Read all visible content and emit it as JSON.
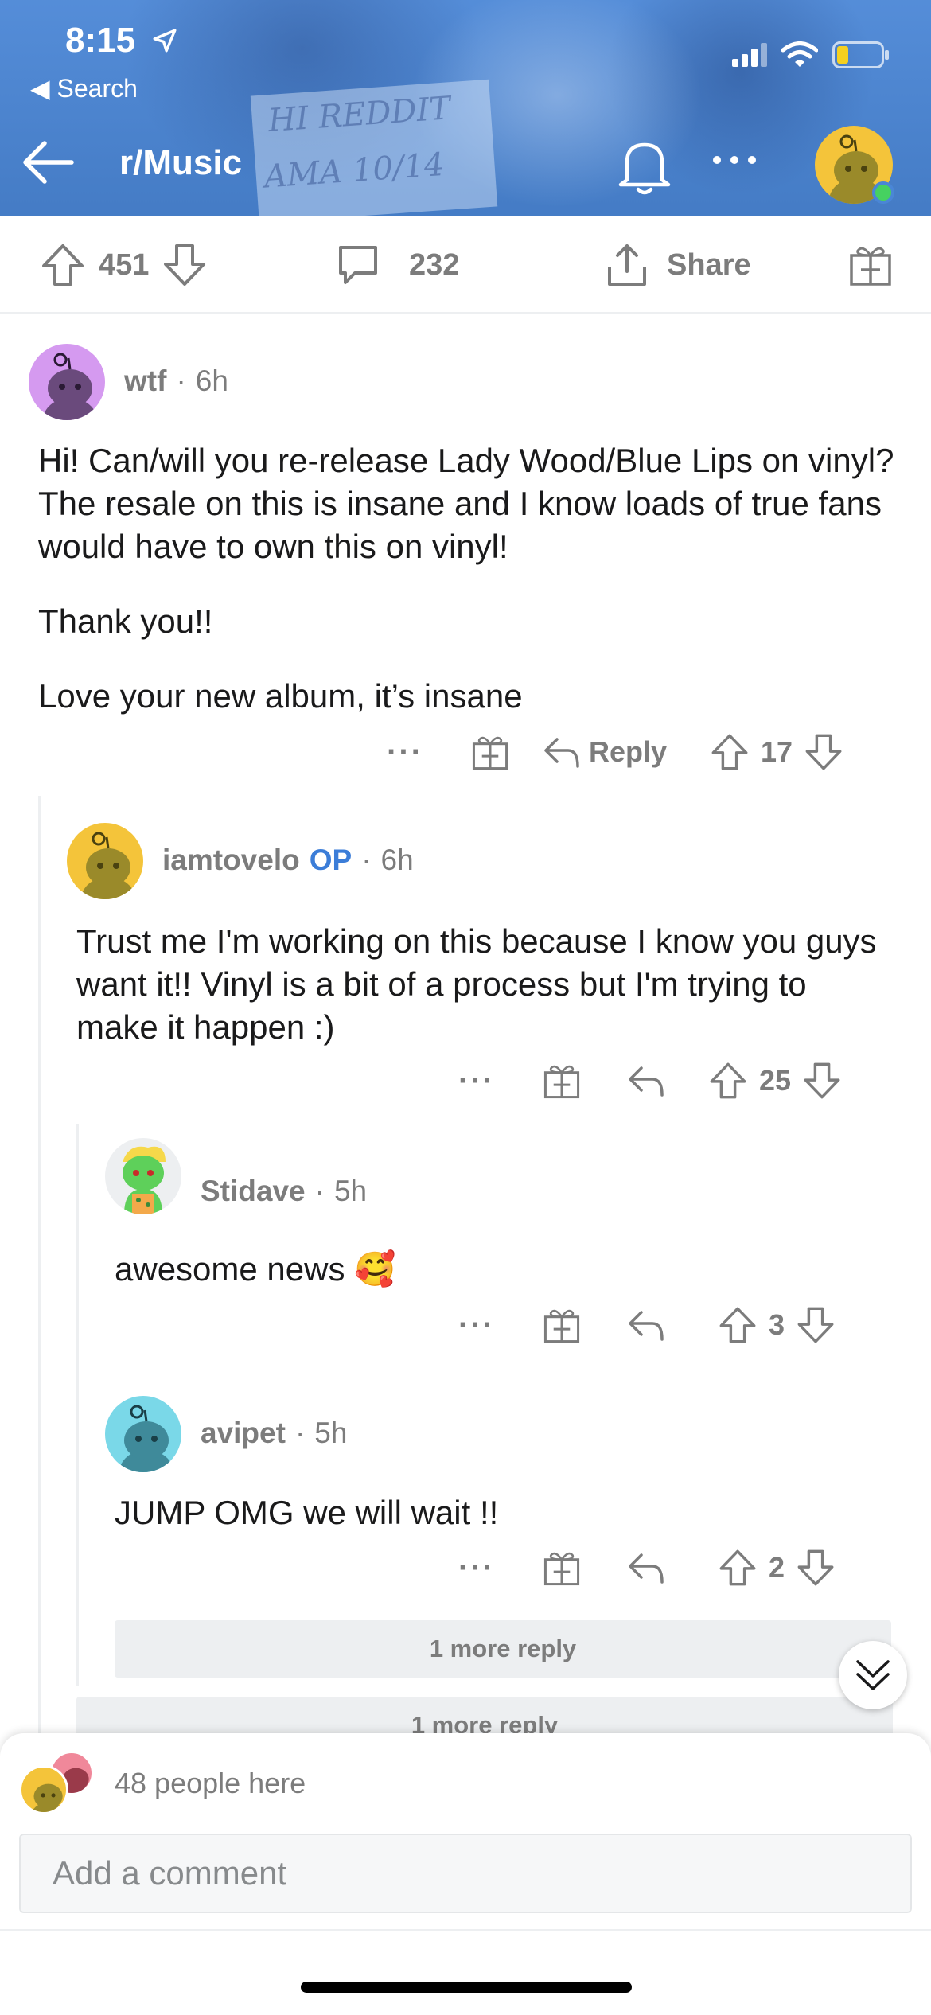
{
  "status_bar": {
    "time": "8:15",
    "back_app": "Search"
  },
  "header": {
    "subreddit": "r/Music",
    "photo_sign_text": [
      "HI REDDIT",
      "AMA 10/14"
    ]
  },
  "action_bar": {
    "upvotes": "451",
    "comments": "232",
    "share_label": "Share"
  },
  "comments": [
    {
      "user": "wtf",
      "time": "6h",
      "paragraphs": [
        "Hi! Can/will you re-release Lady Wood/Blue Lips on vinyl? The resale on this is insane and I know loads of true fans would have to own this on vinyl!",
        "Thank you!!",
        "Love your new album, it’s insane"
      ],
      "reply_label": "Reply",
      "score": "17"
    },
    {
      "user": "iamtovelo",
      "op_badge": "OP",
      "time": "6h",
      "paragraphs": [
        "Trust me I'm working on this because I know you guys want it!! Vinyl is a bit of a process but I'm trying to make it happen :)"
      ],
      "score": "25"
    },
    {
      "user": "Stidave",
      "time": "5h",
      "paragraphs": [
        "awesome news 🥰"
      ],
      "score": "3"
    },
    {
      "user": "avipet",
      "time": "5h",
      "paragraphs": [
        "JUMP OMG we will wait !!"
      ],
      "score": "2"
    }
  ],
  "more_replies": [
    "1 more reply",
    "1 more reply"
  ],
  "composer": {
    "people_here": "48 people here",
    "placeholder": "Add a comment"
  },
  "colors": {
    "header_blue": "#4a86d6",
    "op_blue": "#3b7dd8",
    "meta_gray": "#7c7c7c",
    "online_green": "#46d160"
  },
  "icons": [
    "location-arrow-icon",
    "signal-icon",
    "wifi-icon",
    "battery-icon",
    "back-arrow-icon",
    "bell-icon",
    "more-icon",
    "upvote-icon",
    "downvote-icon",
    "comment-icon",
    "share-icon",
    "award-icon",
    "reply-icon",
    "chevron-double-down-icon"
  ]
}
